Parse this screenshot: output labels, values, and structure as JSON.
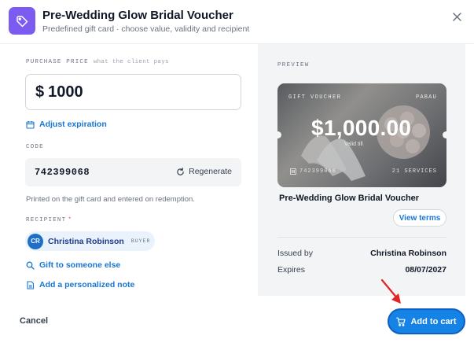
{
  "header": {
    "title": "Pre-Wedding Glow Bridal Voucher",
    "subtitle": "Predefined gift card · choose value, validity and recipient"
  },
  "purchase": {
    "label": "PURCHASE PRICE",
    "hint": "what the client pays",
    "currency_symbol": "$",
    "value": "1000"
  },
  "expiration": {
    "link_label": "Adjust expiration"
  },
  "code": {
    "label": "CODE",
    "value": "742399068",
    "regenerate_label": "Regenerate",
    "help_text": "Printed on the gift card and entered on redemption."
  },
  "recipient": {
    "label": "RECIPIENT",
    "required_mark": "*",
    "initials": "CR",
    "name": "Christina Robinson",
    "tag": "BUYER",
    "gift_link": "Gift to someone else",
    "note_link": "Add a personalized note"
  },
  "preview": {
    "label": "PREVIEW",
    "card": {
      "brand": "GIFT VOUCHER",
      "merchant": "PABAU",
      "value": "$1,000.00",
      "valid_text": "Valid till",
      "code": "742399068",
      "services": "21 SERVICES"
    },
    "title": "Pre-Wedding Glow Bridal Voucher",
    "view_terms_label": "View terms",
    "issued_by_label": "Issued by",
    "issued_by_value": "Christina Robinson",
    "expires_label": "Expires",
    "expires_value": "08/07/2027"
  },
  "footer": {
    "cancel_label": "Cancel",
    "add_to_cart_label": "Add to cart"
  },
  "colors": {
    "accent_purple": "#7c5cf0",
    "link_blue": "#1976d2",
    "primary_button": "#1582e6",
    "annotation_arrow": "#e02424"
  },
  "icons": {
    "header": "tag-icon",
    "close": "close-icon",
    "expiration": "calendar-icon",
    "regenerate": "refresh-icon",
    "gift": "search-icon",
    "note": "note-icon",
    "cart": "cart-icon"
  }
}
